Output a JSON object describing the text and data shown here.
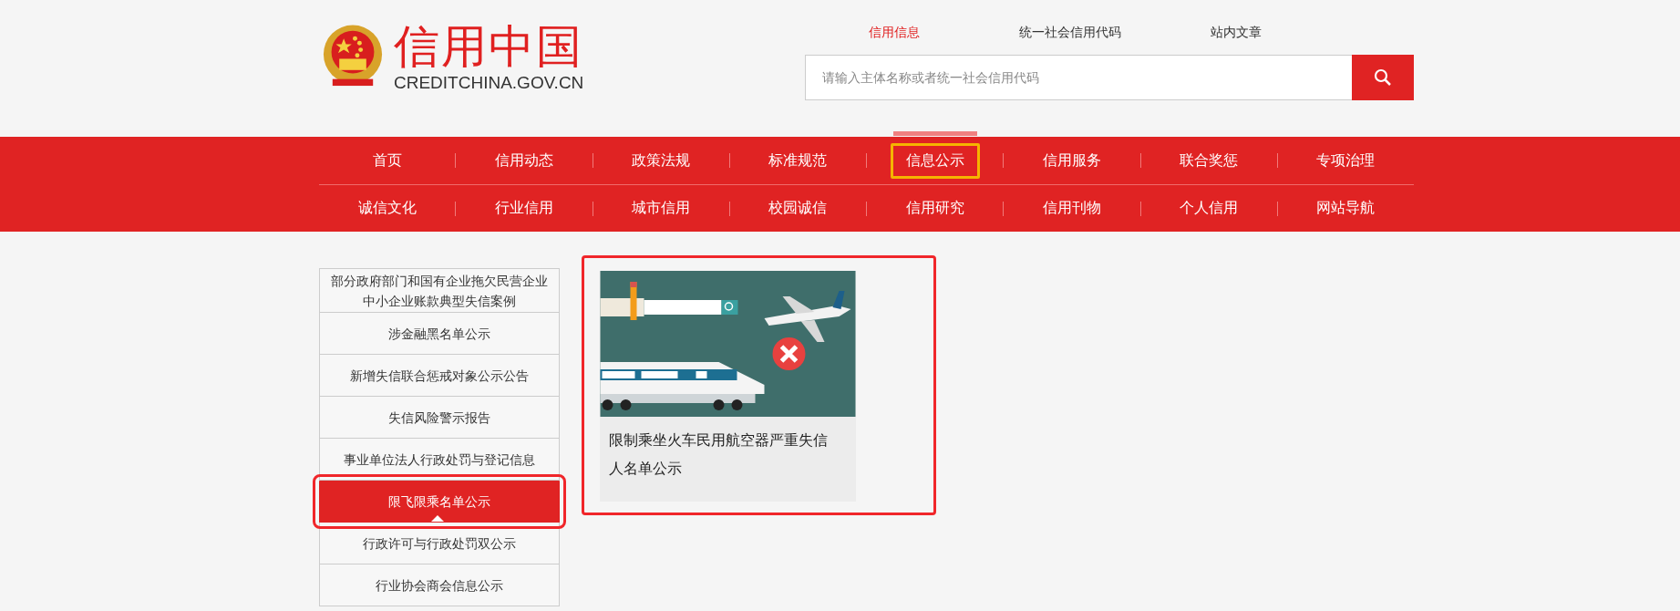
{
  "logo": {
    "title": "信用中国",
    "domain": "CREDITCHINA.GOV.CN"
  },
  "search": {
    "tabs": [
      {
        "label": "信用信息",
        "selected": true
      },
      {
        "label": "统一社会信用代码",
        "selected": false
      },
      {
        "label": "站内文章",
        "selected": false
      }
    ],
    "placeholder": "请输入主体名称或者统一社会信用代码"
  },
  "nav": {
    "rows": [
      [
        {
          "label": "首页",
          "selected": false
        },
        {
          "label": "信用动态",
          "selected": false
        },
        {
          "label": "政策法规",
          "selected": false
        },
        {
          "label": "标准规范",
          "selected": false
        },
        {
          "label": "信息公示",
          "selected": true
        },
        {
          "label": "信用服务",
          "selected": false
        },
        {
          "label": "联合奖惩",
          "selected": false
        },
        {
          "label": "专项治理",
          "selected": false
        }
      ],
      [
        {
          "label": "诚信文化",
          "selected": false
        },
        {
          "label": "行业信用",
          "selected": false
        },
        {
          "label": "城市信用",
          "selected": false
        },
        {
          "label": "校园诚信",
          "selected": false
        },
        {
          "label": "信用研究",
          "selected": false
        },
        {
          "label": "信用刊物",
          "selected": false
        },
        {
          "label": "个人信用",
          "selected": false
        },
        {
          "label": "网站导航",
          "selected": false
        }
      ]
    ]
  },
  "sidebar": {
    "items": [
      {
        "label": "部分政府部门和国有企业拖欠民营企业中小企业账款典型失信案例",
        "selected": false
      },
      {
        "label": "涉金融黑名单公示",
        "selected": false
      },
      {
        "label": "新增失信联合惩戒对象公示公告",
        "selected": false
      },
      {
        "label": "失信风险警示报告",
        "selected": false
      },
      {
        "label": "事业单位法人行政处罚与登记信息",
        "selected": false
      },
      {
        "label": "限飞限乘名单公示",
        "selected": true
      },
      {
        "label": "行政许可与行政处罚双公示",
        "selected": false
      },
      {
        "label": "行业协会商会信息公示",
        "selected": false
      }
    ]
  },
  "cards": [
    {
      "title": "限制乘坐火车民用航空器严重失信人名单公示",
      "highlighted": true
    }
  ]
}
